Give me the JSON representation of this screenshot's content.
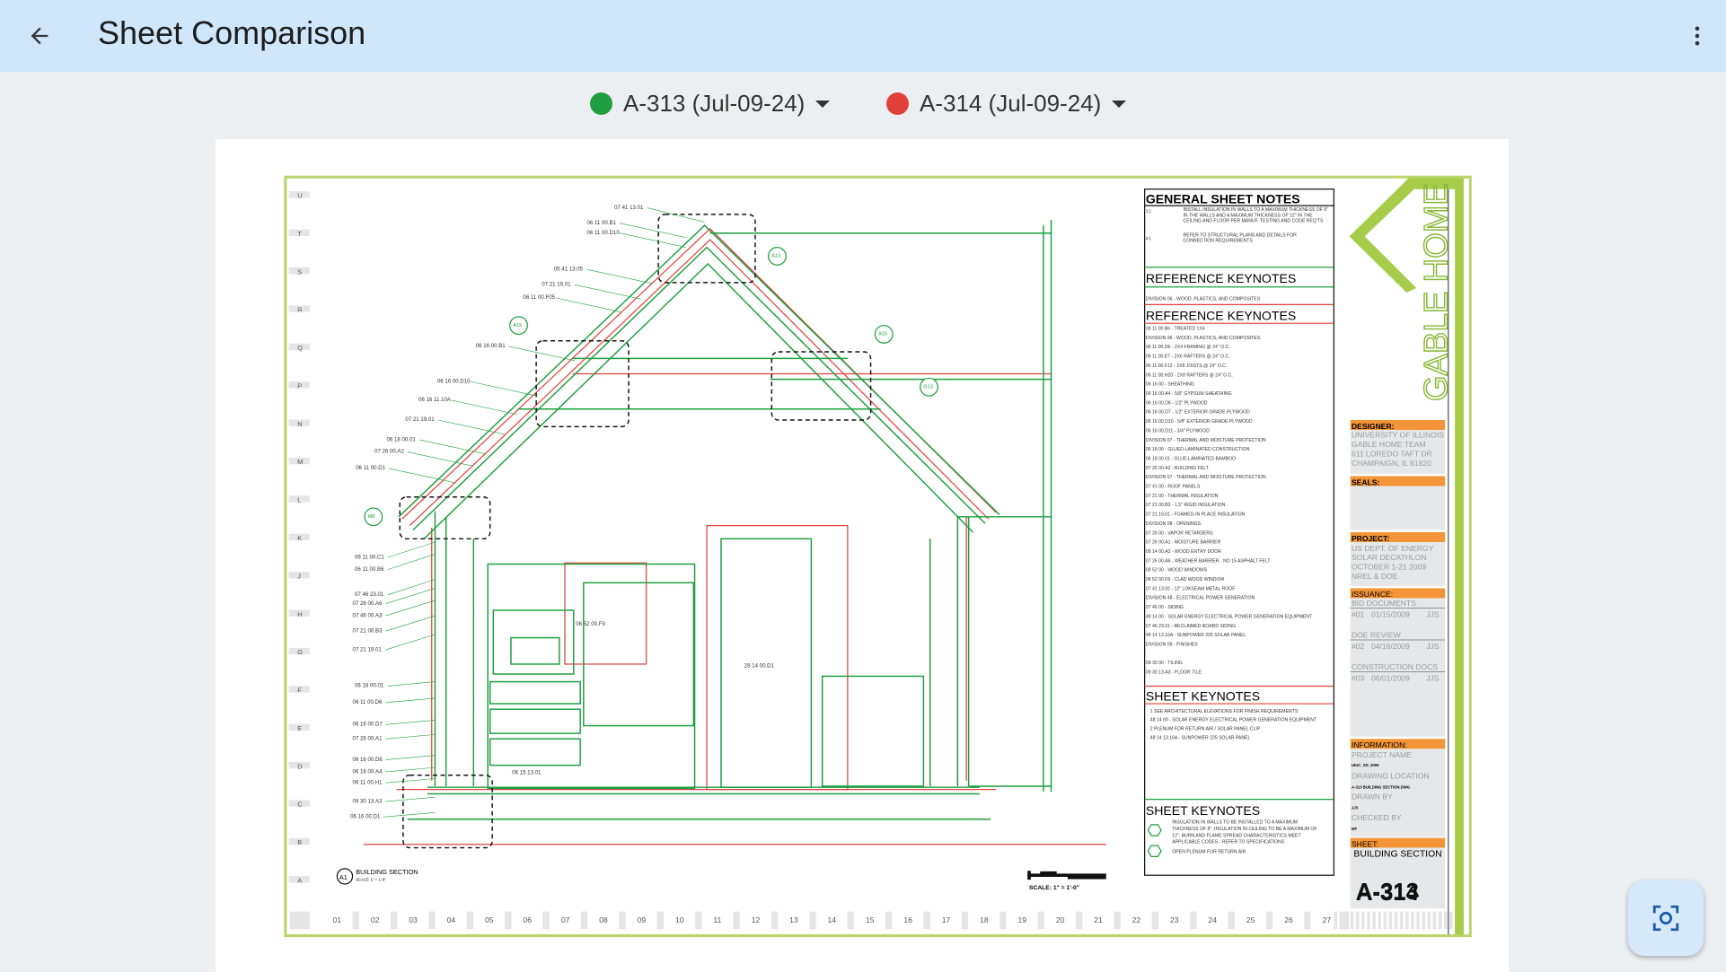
{
  "header": {
    "title": "Sheet Comparison"
  },
  "selectors": [
    {
      "label": "A-313 (Jul-09-24)",
      "color": "#1e9e3e"
    },
    {
      "label": "A-314 (Jul-09-24)",
      "color": "#e0403a"
    }
  ],
  "drawing": {
    "grid_rows": [
      "U",
      "T",
      "S",
      "R",
      "Q",
      "P",
      "N",
      "M",
      "L",
      "K",
      "J",
      "H",
      "G",
      "F",
      "E",
      "D",
      "C",
      "B",
      "A"
    ],
    "grid_cols": [
      "01",
      "02",
      "03",
      "04",
      "05",
      "06",
      "07",
      "08",
      "09",
      "10",
      "11",
      "12",
      "13",
      "14",
      "15",
      "16",
      "17",
      "18",
      "19",
      "20",
      "21",
      "22",
      "23",
      "24",
      "25",
      "26",
      "27"
    ],
    "left_labels": [
      "07 41 13.01",
      "06 11 00.B1",
      "06 11 00.D10",
      "05 41 13.05",
      "07 21 19.01",
      "06 11 00.F05",
      "06 16 00.B1",
      "06 16 00.D10",
      "06 16 11.10A",
      "07 21 19.01",
      "06 18 00.01",
      "07 26 00.A2",
      "06 11 00.D1",
      "06 11 00.C1",
      "06 11 00.B6",
      "07 46 23.01",
      "07 26 00.A6",
      "07 46 00.A3",
      "07 21 00.B3",
      "07 21 19.01",
      "06 18 00.01",
      "06 11 00.D6",
      "06 16 00.D7",
      "07 26 00.A1",
      "06 16 00.D6",
      "06 16 00.A4",
      "06 11 00.H1",
      "09 30 13.A3",
      "06 16 00.D1"
    ],
    "inner_labels": [
      "06 52 00.F9",
      "28 14 00.D1",
      "06 15 13.01"
    ],
    "section_tag": "A1",
    "section_title": "BUILDING SECTION",
    "section_scale": "SCALE: 1\" = 1'-0\"",
    "scale_bar_label": "SCALE: 1\" = 1'-0\"",
    "callouts": [
      "A13",
      "A15",
      "A15",
      "G13",
      "M8"
    ]
  },
  "notes": {
    "general_title": "GENERAL SHEET NOTES",
    "general": [
      {
        "num": "1.)",
        "text": "INSTALL INSULATION IN WALLS TO A MAXIMUM THICKNESS OF 8\" IN THE WALLS AND A MAXIMUM THICKNESS OF 12\" IN THE CEILING AND FLOOR PER MANUF. TESTING AND CODE REQ'TS"
      },
      {
        "num": "2.)",
        "text": "REFER TO STRUCTURAL PLANS AND DETAILS FOR CONNECTION REQUIREMENTS"
      }
    ],
    "ref_title_1": "REFERENCE KEYNOTES",
    "ref_division_1": "DIVISION 06 - WOOD, PLASTICS, AND COMPOSITES",
    "ref_title_2": "REFERENCE KEYNOTES",
    "ref_lines": [
      "06 11 00.B6   -   TREATED 1X4",
      "DIVISION 06 - WOOD, PLASTICS, AND COMPOSITES",
      "06 11 00.D6   -   2X4 FRAMING @ 24\" O.C.",
      "06 11 00.E7   -   2X6 RAFTERS @ 24\" O.C.",
      "06 11 00.F12   -   2X8 JOISTS @ 24\" O.C.",
      "06 11 00.H20   -   2X8 RAFTERS @ 24\" O.C.",
      "06 16 00 - SHEATHING",
      "06 16 00.A4   -   5/8\" GYPSUM SHEATHING",
      "06 16 00.D6   -   1/2\" PLYWOOD",
      "06 16 00.D7   -   1/2\" EXTERIOR GRADE PLYWOOD",
      "06 16 00.D10   -   5/8\" EXTERIOR GRADE PLYWOOD",
      "06 16 00.D11   -   3/4\" PLYWOOD",
      "DIVISION 07 - THERMAL AND MOISTURE PROTECTION",
      "06 18 00 - GLUED-LAMINATED CONSTRUCTION",
      "06 18 00.01   -   GLUE-LAMINATED BAMBOO",
      "07 26 00.A2   -   BUILDING FELT",
      "DIVISION 07 - THERMAL AND MOISTURE PROTECTION",
      "07 41 00 - ROOF PANELS",
      "07 21 00 - THERMAL INSULATION",
      "07 21 00.B3   -   1.5\" RIGID INSULATION",
      "07 21 19.01   -   FOAMED-IN PLACE INSULATION",
      "DIVISION 08 - OPENINGS",
      "07 26 00 - VAPOR RETARDERS",
      "07 26 00.A1   -   MOISTURE BARRIER",
      "08 14 00.A2   -   WOOD ENTRY DOOR",
      "07 26 00.A6   -   WEATHER BARRIER - NO 15 ASPHALT FELT",
      "08 52 00 - WOOD WINDOWS",
      "08 52 00.F9   -   CLAD WOOD WINDOW",
      "07 41 13.02   -   12\" LOKSEAM METAL ROOF",
      "DIVISION 48 - ELECTRICAL POWER GENERATION",
      "07 46 00 - SIDING",
      "48 14 00 - SOLAR ENERGY ELECTRICAL POWER GENERATION EQUIPMENT",
      "07 46 23.01   -   RECLAIMED BOARD SIDING",
      "48 14 13.16A   -   SUNPOWER 225 SOLAR PANEL",
      "DIVISION 09 - FINISHES",
      "",
      "09 30 00 - TILING",
      "09 30 13.A3   -   FLOOR TILE"
    ],
    "sheet_title_1": "SHEET KEYNOTES",
    "sheet_lines_1": [
      "1   SEE ARCHITECTURAL ELEVATIONS FOR FINISH REQUIREMENTS",
      "48 14 00 - SOLAR ENERGY ELECTRICAL POWER GENERATION EQUIPMENT",
      "2   PLENUM FOR RETURN AIR / SOLAR PANEL CLIP",
      "48 14 13.16A   -   SUNPOWER 225 SOLAR PANEL"
    ],
    "sheet_title_2": "SHEET KEYNOTES",
    "sheet_lines_2": [
      "INSULATION IN WALLS TO BE INSTALLED TO A MAXIMUM",
      "THICKNESS OF 8\". INSULATION IN CEILING TO BE A MAXIMUM OF",
      "12\". BURN AND FLAME SPREAD CHARACTERISTICS MEET",
      "APPLICABLE CODES - REFER TO SPECIFICATIONS",
      "OPEN PLENUM FOR RETURN AIR"
    ]
  },
  "titleblock": {
    "logo": "GABLE HOME",
    "designer_label": "DESIGNER:",
    "designer": [
      "UNIVERSITY OF ILLINOIS",
      "GABLE HOME TEAM",
      "611 LOREDO TAFT DR.",
      "CHAMPAIGN, IL 61820"
    ],
    "seals_label": "SEALS:",
    "project_label": "PROJECT:",
    "project": [
      "US DEPT. OF ENERGY",
      "SOLAR DECATHLON",
      "OCTOBER 1-21 2009",
      "NREL & DOE"
    ],
    "issuance_label": "ISSUANCE:",
    "issuance": [
      {
        "name": "BID DOCUMENTS",
        "num": "#01",
        "date": "01/15/2009",
        "by": "JJS"
      },
      {
        "name": "DOE REVIEW",
        "num": "#02",
        "date": "04/16/2009",
        "by": "JJS"
      },
      {
        "name": "CONSTRUCTION DOCS",
        "num": "#03",
        "date": "06/01/2009",
        "by": "JJS"
      }
    ],
    "information_label": "INFORMATION:",
    "project_name_label": "PROJECT NAME",
    "project_name": "UIUC_SD_2009",
    "drawing_location_label": "DRAWING LOCATION",
    "drawing_location": "A-313 BUILDING SECTION.DWG",
    "drawn_by_label": "DRAWN BY",
    "drawn_by": "JJS",
    "checked_by_label": "CHECKED BY",
    "checked_by": "MT",
    "sheet_label": "SHEET:",
    "sheet_name": "BUILDING SECTION",
    "sheet_number": "A-313",
    "sheet_number_overlay": "A-314",
    "accent": "#f39536",
    "brand_green": "#a6cc4a"
  },
  "colors": {
    "sheet_a": "#1e9e3e",
    "sheet_b": "#e0403a"
  }
}
